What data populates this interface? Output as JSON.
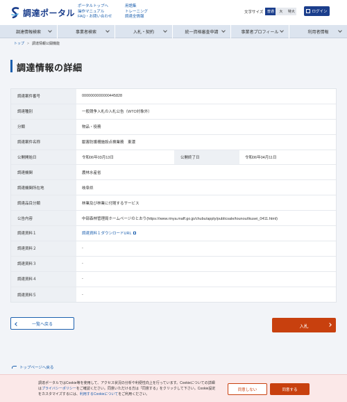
{
  "header": {
    "logo_text": "調達ポータル",
    "links_col1": [
      "ポータルトップへ",
      "操作マニュアル",
      "FAQ・お問い合わせ"
    ],
    "links_col2": [
      "用語集",
      "トレーニング",
      "調達全情報"
    ],
    "text_size_label": "文字サイズ",
    "text_size_options": [
      "普通",
      "大",
      "特大"
    ],
    "login_label": "ログイン"
  },
  "nav": {
    "items": [
      "調達情報検索",
      "事業者検索",
      "入札・契約",
      "統一資格審査申請",
      "事業者プロフィール",
      "利用者情報"
    ]
  },
  "breadcrumb": {
    "home": "トップ",
    "current": "調達情報公開機能"
  },
  "page_title": "調達情報の詳細",
  "detail": {
    "case_number_label": "調達案件番号",
    "case_number": "0000000000000445828",
    "type_label": "調達種別",
    "type": "一般競争入札の入札公告（WTO対象外）",
    "category_label": "分類",
    "category": "物品・役務",
    "case_name_label": "調達案件名称",
    "case_name": "獣害防護柵施設点検業務　東濃",
    "publish_start_label": "公開開始日",
    "publish_start": "令和06年03月13日",
    "publish_end_label": "公開終了日",
    "publish_end": "令和06年04月11日",
    "agency_label": "調達機関",
    "agency": "農林水産省",
    "location_label": "調達機関所在地",
    "location": "岐阜県",
    "item_class_label": "調達品目分類",
    "item_class": "林業及び林業に付随するサービス",
    "notice_label": "公告内容",
    "notice": "中部森林管理局ホームページのとおり(https://www.rinya.maff.go.jp/chubu/apply/publicsale/tounou/ikusei_0411.html)",
    "doc1_label": "調達資料１",
    "doc1": "調達資料１ダウンロードURL",
    "doc2_label": "調達資料２",
    "doc2": "-",
    "doc3_label": "調達資料３",
    "doc3": "-",
    "doc4_label": "調達資料４",
    "doc4": "-",
    "doc5_label": "調達資料５",
    "doc5": "-"
  },
  "buttons": {
    "back": "一覧へ戻る",
    "bid": "入札",
    "pagetop": "トップページへ戻る"
  },
  "cookie": {
    "text_pre": "調達ポータルではCookie等を使用して、アクセス状況の分析や利便性向上を行っています。Cookieについての詳細は",
    "privacy_link": "プライバシーポリシー",
    "text_mid": "をご確認ください。同意いただける方は「同意する」をクリックして下さい。Cookie設定をカスタマイズするには、",
    "cookie_link": "利用するCookieについて",
    "text_post": "をご利用ください。",
    "decline": "同意しない",
    "accept": "同意する"
  },
  "colors": {
    "brand": "#1b3e8c",
    "link": "#1b5fae",
    "accent": "#c8400e"
  }
}
